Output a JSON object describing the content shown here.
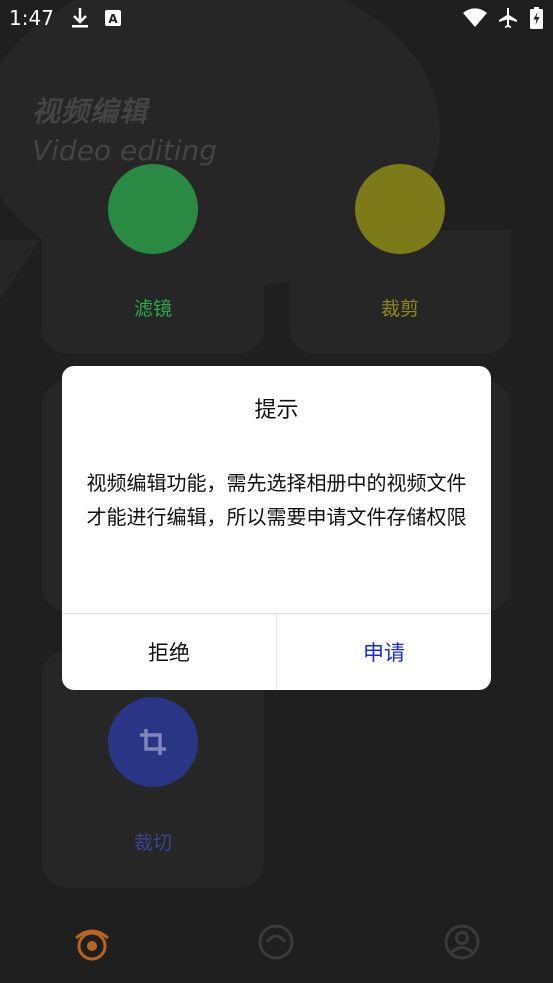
{
  "status_bar": {
    "time": "1:47",
    "icons": [
      "download-icon",
      "font-app-icon",
      "wifi-icon",
      "airplane-icon",
      "battery-charging-icon"
    ]
  },
  "header": {
    "title_cn": "视频编辑",
    "title_en": "Video editing"
  },
  "cards": [
    {
      "label": "滤镜",
      "color": "#2fa84f"
    },
    {
      "label": "裁剪",
      "color": "#8f8a1a"
    },
    {
      "label": "裁切",
      "color": "#2f3a8a"
    }
  ],
  "dialog": {
    "title": "提示",
    "message": "视频编辑功能，需先选择相册中的视频文件才能进行编辑，所以需要申请文件存储权限",
    "deny_label": "拒绝",
    "allow_label": "申请"
  },
  "bottom_nav": {
    "items": [
      "camera-eye-icon",
      "face-icon",
      "profile-icon"
    ],
    "active_color": "#b8651f"
  }
}
